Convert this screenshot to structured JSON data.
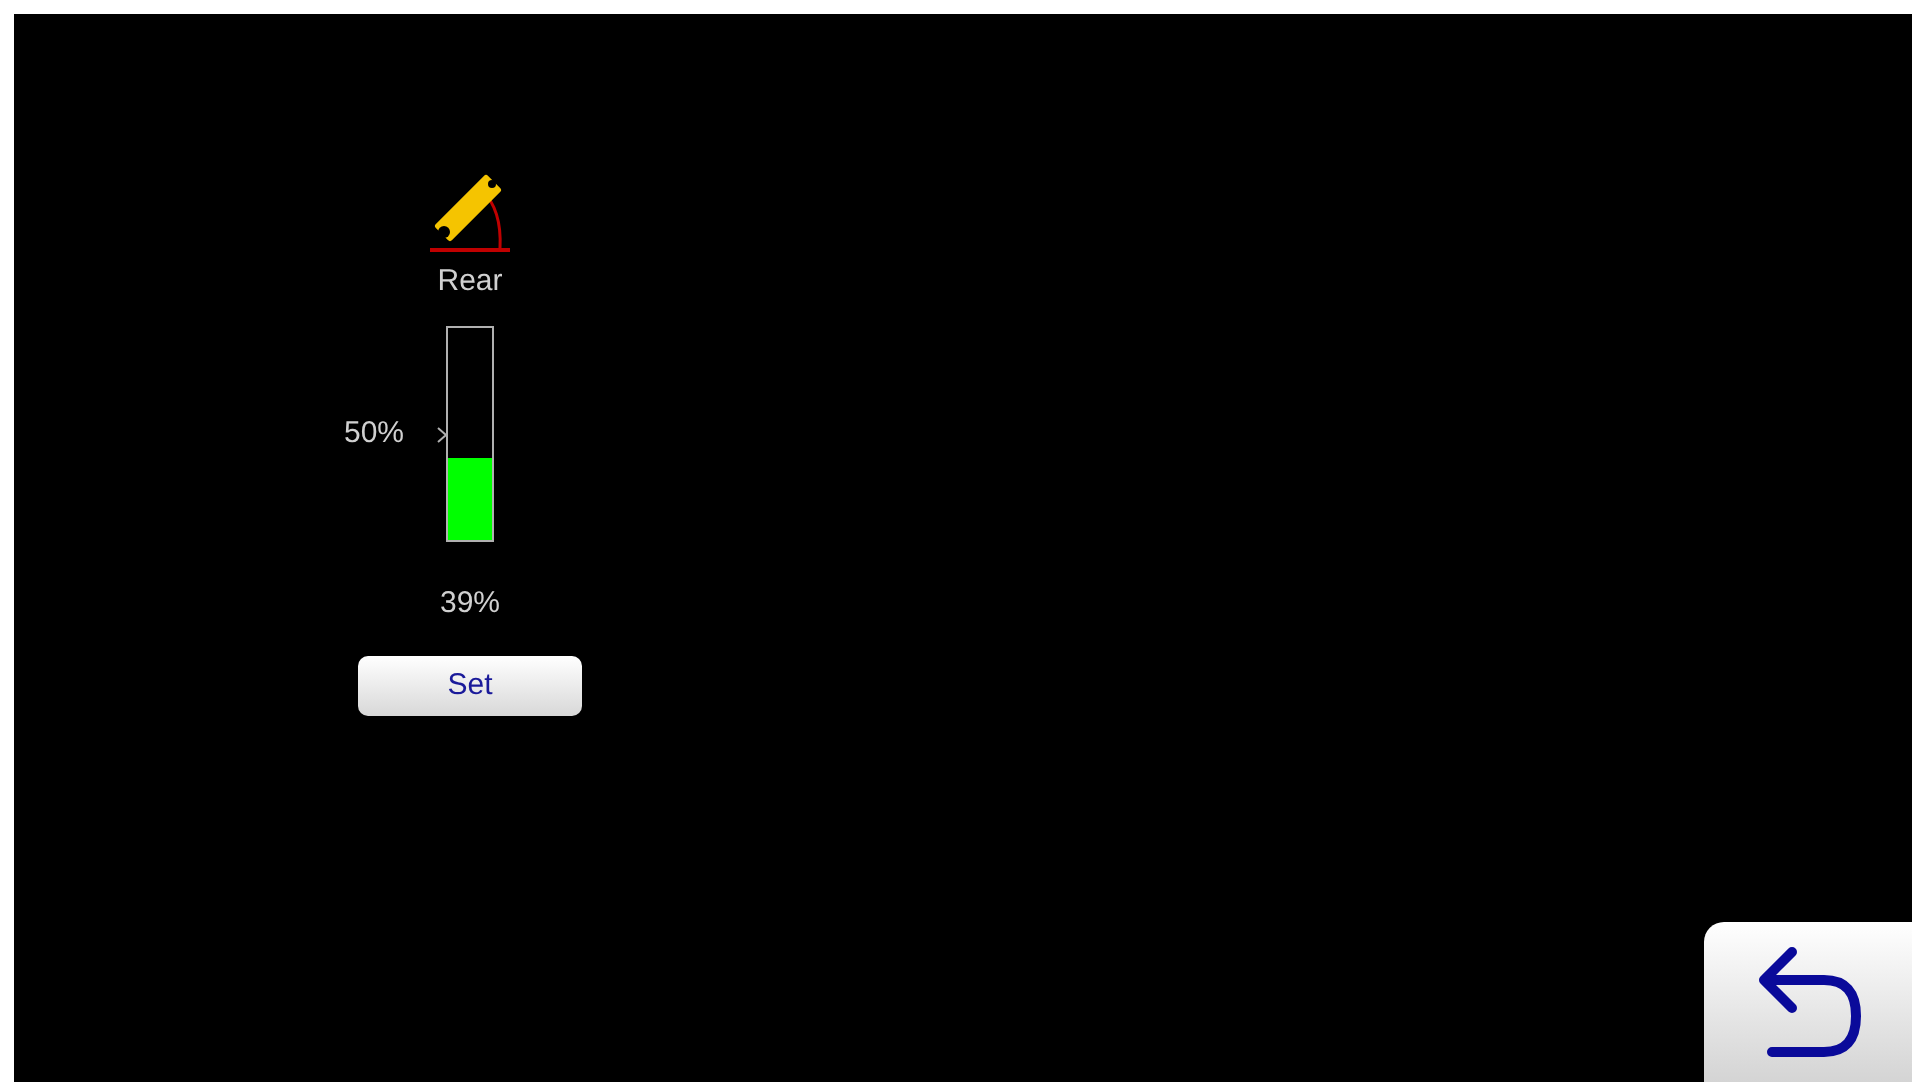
{
  "actuator": {
    "label": "Rear",
    "target": {
      "label": "50%",
      "level": 0.5
    },
    "level": 0.39,
    "reading": "39%",
    "button": "Set"
  },
  "back_button": {
    "kind": "back"
  }
}
